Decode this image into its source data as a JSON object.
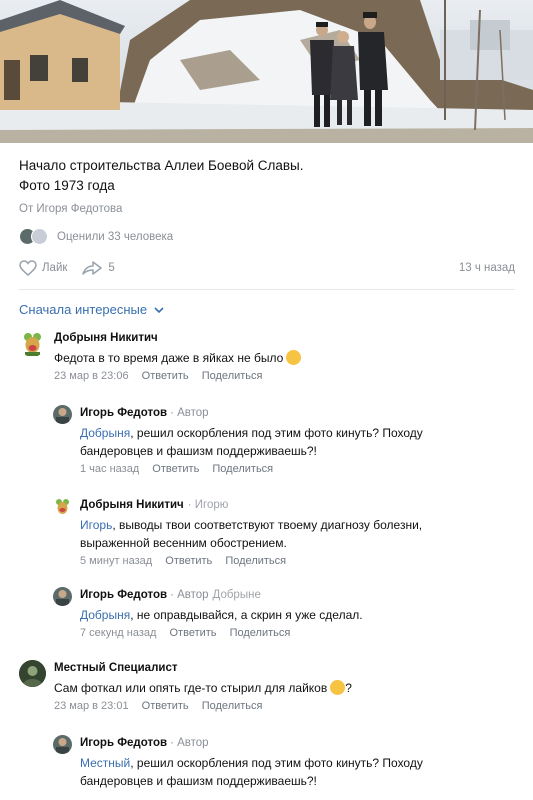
{
  "post": {
    "caption_line1": "Начало строительства Аллеи Боевой Славы.",
    "caption_line2": "Фото 1973 года",
    "from": "От Игоря Федотова",
    "rated": "Оценили 33 человека",
    "like_label": "Лайк",
    "share_count": "5",
    "time": "13 ч назад"
  },
  "sort_label": "Сначала интересные",
  "comments": [
    {
      "author": "Добрыня Никитич",
      "text": "Федота в то время даже в яйках не было",
      "date": "23 мар в 23:06",
      "reply": "Ответить",
      "share": "Поделиться",
      "emoji": "laughing-emoji"
    },
    {
      "author": "Игорь Федотов",
      "badge": "· Автор",
      "mention": "Добрыня",
      "text_line1": ", решил оскорбления под этим фото кинуть? Походу",
      "text_line2": "бандеровцев и фашизм поддерживаешь?!",
      "date": "1 час назад",
      "reply": "Ответить",
      "share": "Поделиться"
    },
    {
      "author": "Добрыня Никитич",
      "reply_to": "· Игорю",
      "mention": "Игорь",
      "text_line1": ", выводы твои соответствуют твоему диагнозу болезни,",
      "text_line2": "выраженной весенним обострением.",
      "date": "5 минут назад",
      "reply": "Ответить",
      "share": "Поделиться"
    },
    {
      "author": "Игорь Федотов",
      "badge": "· Автор",
      "reply_to": "Добрыне",
      "mention": "Добрыня",
      "text_line1": ", не оправдывайся, а скрин я уже сделал.",
      "date": "7 секунд назад",
      "reply": "Ответить",
      "share": "Поделиться"
    },
    {
      "author": "Местный Специалист",
      "text": "Сам фоткал или опять где-то стырил для лайков",
      "date": "23 мар в 23:01",
      "reply": "Ответить",
      "share": "Поделиться",
      "emoji": "thinking-emoji"
    },
    {
      "author": "Игорь Федотов",
      "badge": "· Автор",
      "mention": "Местный",
      "text_line1": ", решил оскорбления под этим фото кинуть? Походу",
      "text_line2": "бандеровцев и фашизм поддерживаешь?!"
    }
  ],
  "colors": {
    "link": "#3a6fb0",
    "muted": "#8a8f96",
    "divider": "#e5e7eb"
  }
}
